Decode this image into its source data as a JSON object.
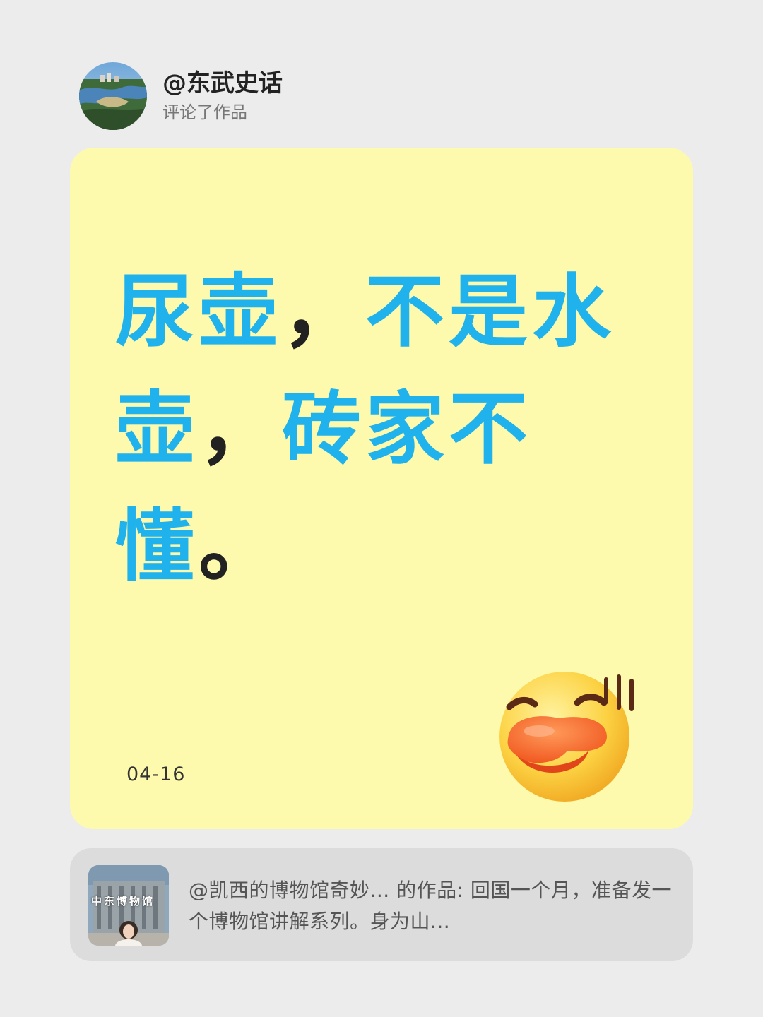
{
  "header": {
    "username": "@东武史话",
    "action": "评论了作品",
    "avatar_icon": "river-landscape-avatar"
  },
  "comment": {
    "segments": [
      {
        "text": "尿壶",
        "accent": true
      },
      {
        "text": "，",
        "accent": false
      },
      {
        "text": "不是水壶",
        "accent": true
      },
      {
        "text": "，",
        "accent": false
      },
      {
        "text": "砖家不懂",
        "accent": true
      },
      {
        "text": "。",
        "accent": false
      }
    ],
    "date": "04-16",
    "emoji_icon": "duck-face-emoji-icon"
  },
  "quoted_work": {
    "text": "@凯西的博物馆奇妙... 的作品: 回国一个月，准备发一个博物馆讲解系列。身为山...",
    "thumbnail_icon": "museum-thumbnail",
    "thumbnail_caption": "中东博物馆"
  },
  "colors": {
    "background": "#ececed",
    "card": "#fdfaad",
    "accent_text": "#1fb2ec",
    "quote_background": "#dcdcdc"
  }
}
